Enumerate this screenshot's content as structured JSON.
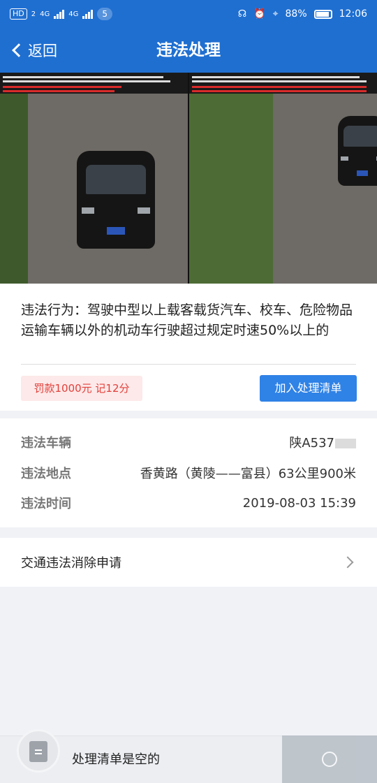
{
  "status_bar": {
    "network_badge": "HD",
    "sim_slot": "2",
    "signal_1": "4G",
    "signal_2": "4G",
    "notification_count": "5",
    "battery": "88%",
    "time": "12:06",
    "icons": [
      "headset-icon",
      "alarm-icon",
      "location-icon",
      "battery-icon"
    ]
  },
  "nav": {
    "back_label": "返回",
    "title": "违法处理"
  },
  "violation": {
    "description": "违法行为：驾驶中型以上载客载货汽车、校车、危险物品运输车辆以外的机动车行驶超过规定时速50%以上的",
    "penalty": "罚款1000元 记12分",
    "add_button": "加入处理清单"
  },
  "details": {
    "vehicle_label": "违法车辆",
    "vehicle_value": "陕A537",
    "location_label": "违法地点",
    "location_value": "香黄路（黄陵——富县）63公里900米",
    "time_label": "违法时间",
    "time_value": "2019-08-03 15:39"
  },
  "action": {
    "label": "交通违法消除申请"
  },
  "bottom": {
    "empty_text": "处理清单是空的"
  },
  "colors": {
    "primary": "#1f6fd1",
    "button": "#2f82e6",
    "penalty_text": "#e2403b",
    "penalty_bg": "#fde9e9"
  }
}
